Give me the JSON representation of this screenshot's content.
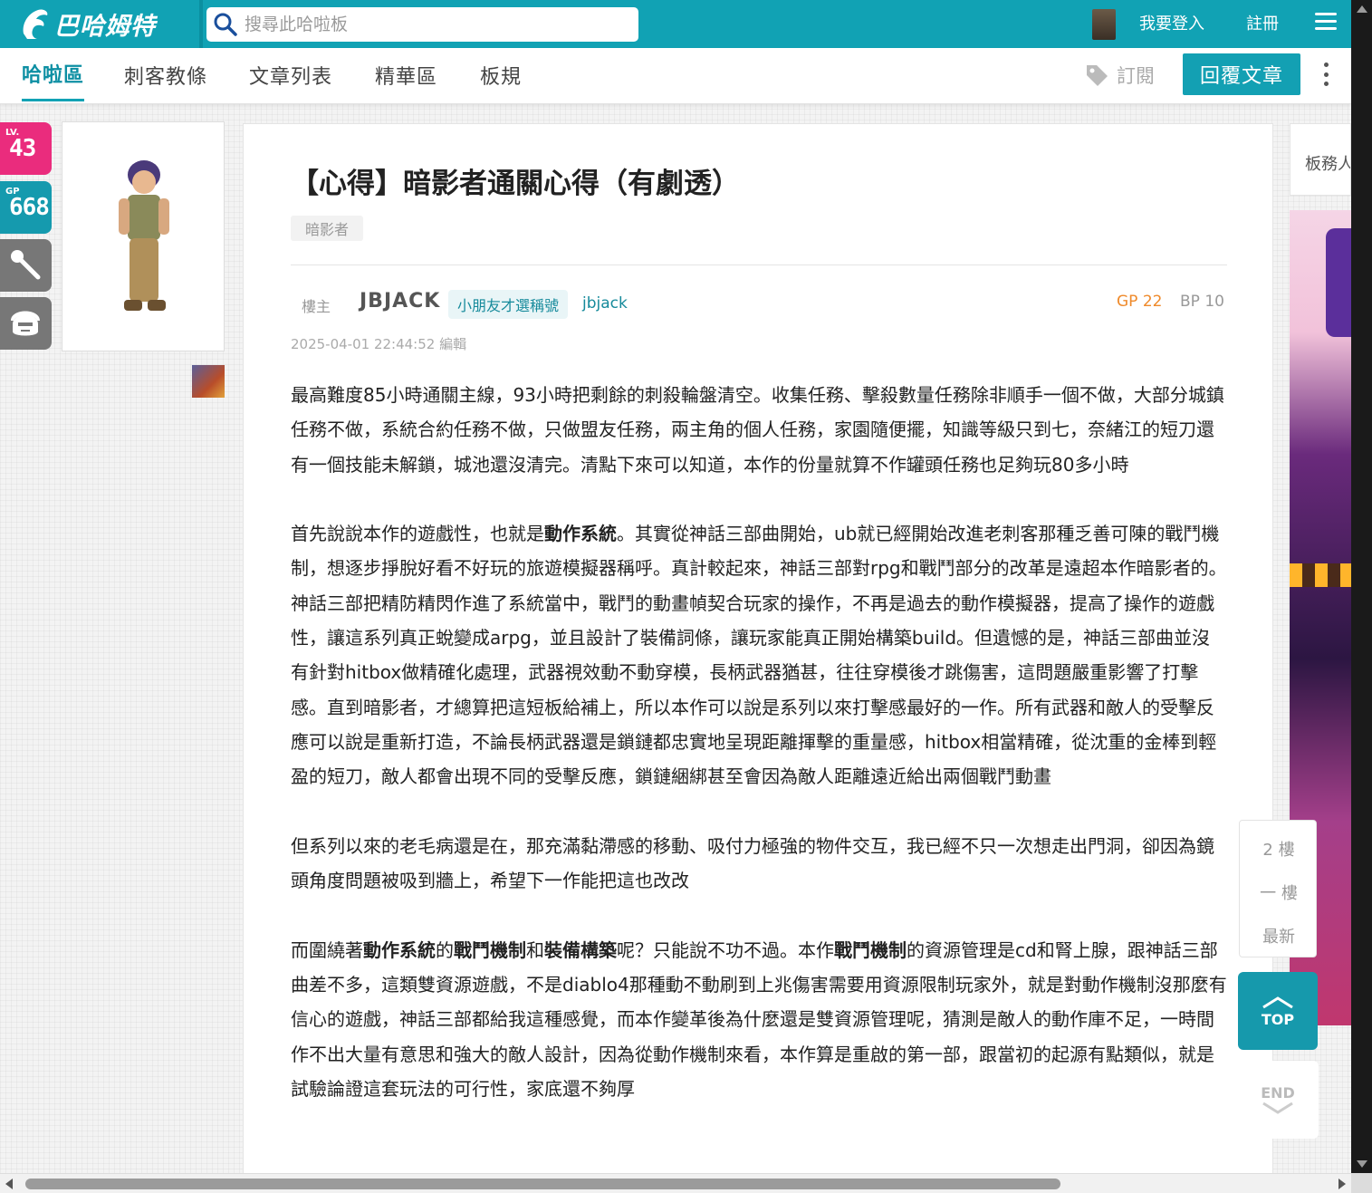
{
  "topbar": {
    "logo_text": "巴哈姆特",
    "search_placeholder": "搜尋此哈啦板",
    "login_label": "我要登入",
    "register_label": "註冊"
  },
  "subnav": {
    "tabs": [
      {
        "label": "哈啦區",
        "active": true
      },
      {
        "label": "刺客教條"
      },
      {
        "label": "文章列表"
      },
      {
        "label": "精華區"
      },
      {
        "label": "板規"
      }
    ],
    "subscribe_label": "訂閱",
    "reply_label": "回覆文章"
  },
  "user_badges": {
    "level_prefix": "LV.",
    "level": "43",
    "gp_prefix": "GP",
    "gp": "668"
  },
  "article": {
    "title": "【心得】暗影者通關心得（有劇透）",
    "tag": "暗影者",
    "floor_label": "樓主",
    "author_name": "JBJACK",
    "author_title": "小朋友才選稱號",
    "author_id": "jbjack",
    "gp": "GP 22",
    "bp": "BP 10",
    "timestamp": "2025-04-01 22:44:52 編輯",
    "paragraphs": [
      [
        {
          "t": "最高難度85小時通關主線，93小時把剩餘的刺殺輪盤清空。收集任務、擊殺數量任務除非順手一個不做，大部分城鎮任務不做，系統合約任務不做，只做盟友任務，兩主角的個人任務，家園隨便擺，知識等級只到七，奈緒江的短刀還有一個技能未解鎖，城池還沒清完。清點下來可以知道，本作的份量就算不作罐頭任務也足夠玩80多小時"
        }
      ],
      [
        {
          "t": "首先說說本作的遊戲性，也就是"
        },
        {
          "t": "動作系統",
          "b": true
        },
        {
          "t": "。其實從神話三部曲開始，ub就已經開始改進老刺客那種乏善可陳的戰鬥機制，想逐步掙脫好看不好玩的旅遊模擬器稱呼。真計較起來，神話三部對rpg和戰鬥部分的改革是遠超本作暗影者的。神話三部把精防精閃作進了系統當中，戰鬥的動畫幀契合玩家的操作，不再是過去的動作模擬器，提高了操作的遊戲性，讓這系列真正蛻變成arpg，並且設計了裝備詞條，讓玩家能真正開始構築build。但遺憾的是，神話三部曲並沒有針對hitbox做精確化處理，武器視效動不動穿模，長柄武器猶甚，往往穿模後才跳傷害，這問題嚴重影響了打擊感。直到暗影者，才總算把這短板給補上，所以本作可以說是系列以來打擊感最好的一作。所有武器和敵人的受擊反應可以說是重新打造，不論長柄武器還是鎖鏈都忠實地呈現距離揮擊的重量感，hitbox相當精確，從沈重的金棒到輕盈的短刀，敵人都會出現不同的受擊反應，鎖鏈綑綁甚至會因為敵人距離遠近給出兩個戰鬥動畫"
        }
      ],
      [
        {
          "t": "但系列以來的老毛病還是在，那充滿黏滯感的移動、吸付力極強的物件交互，我已經不只一次想走出門洞，卻因為鏡頭角度問題被吸到牆上，希望下一作能把這也改改"
        }
      ],
      [
        {
          "t": "而圍繞著"
        },
        {
          "t": "動作系統",
          "b": true
        },
        {
          "t": "的"
        },
        {
          "t": "戰鬥機制",
          "b": true
        },
        {
          "t": "和"
        },
        {
          "t": "裝備構築",
          "b": true
        },
        {
          "t": "呢？只能說不功不過。本作"
        },
        {
          "t": "戰鬥機制",
          "b": true
        },
        {
          "t": "的資源管理是cd和腎上腺，跟神話三部曲差不多，這類雙資源遊戲，不是diablo4那種動不動刷到上兆傷害需要用資源限制玩家外，就是對動作機制沒那麼有信心的遊戲，神話三部都給我這種感覺，而本作變革後為什麼還是雙資源管理呢，猜測是敵人的動作庫不足，一時間作不出大量有意思和強大的敵人設計，因為從動作機制來看，本作算是重啟的第一部，跟當初的起源有點類似，就是試驗論證這套玩法的可行性，家底還不夠厚"
        }
      ]
    ]
  },
  "sidebar": {
    "admin_label": "板務人員"
  },
  "floor_nav": {
    "items": [
      "2 樓",
      "一 樓",
      "最新"
    ],
    "top_label": "TOP",
    "end_label": "END"
  },
  "colors": {
    "brand": "#11a2b4",
    "level_badge": "#ea2c7d",
    "gp_badge": "#159aae",
    "gp_text": "#ef8a2b"
  }
}
